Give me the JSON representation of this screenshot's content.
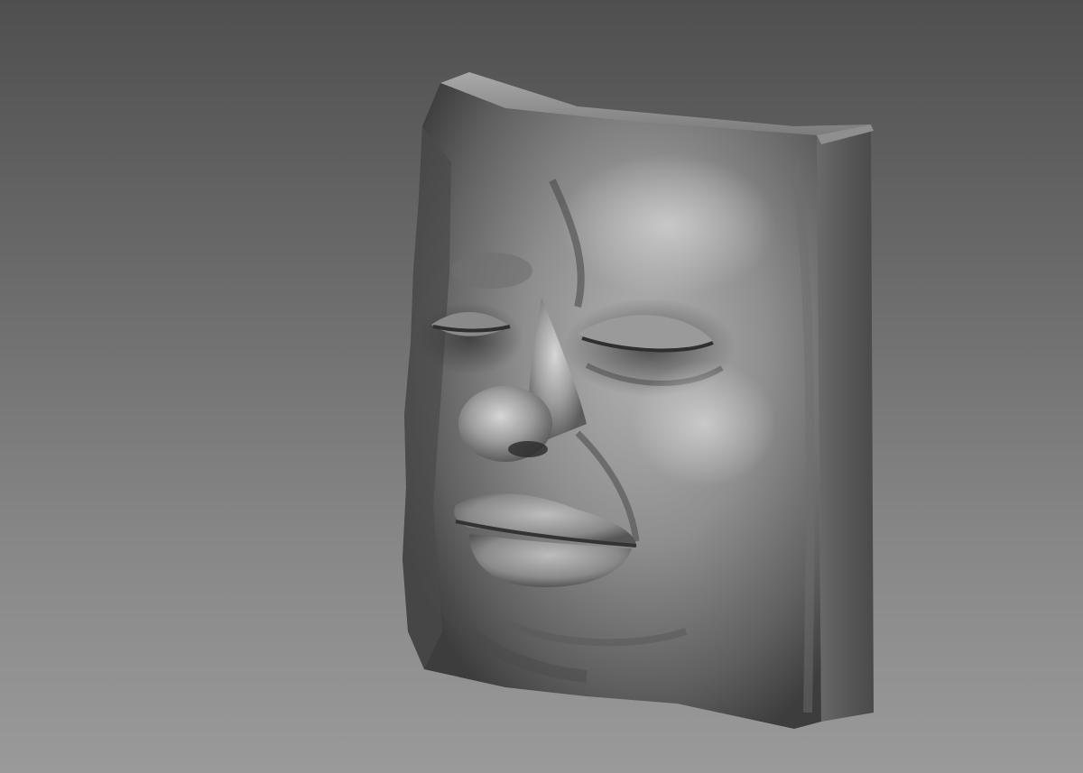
{
  "scene": {
    "subject": "sculpted-face-relief",
    "background_gradient": [
      "#4f4f4f",
      "#6a6a6a",
      "#878787",
      "#9a9a9a"
    ],
    "material_color": "#8c8c8c",
    "highlight_color": "#d8d8d8",
    "shadow_color": "#2e2e2e"
  }
}
